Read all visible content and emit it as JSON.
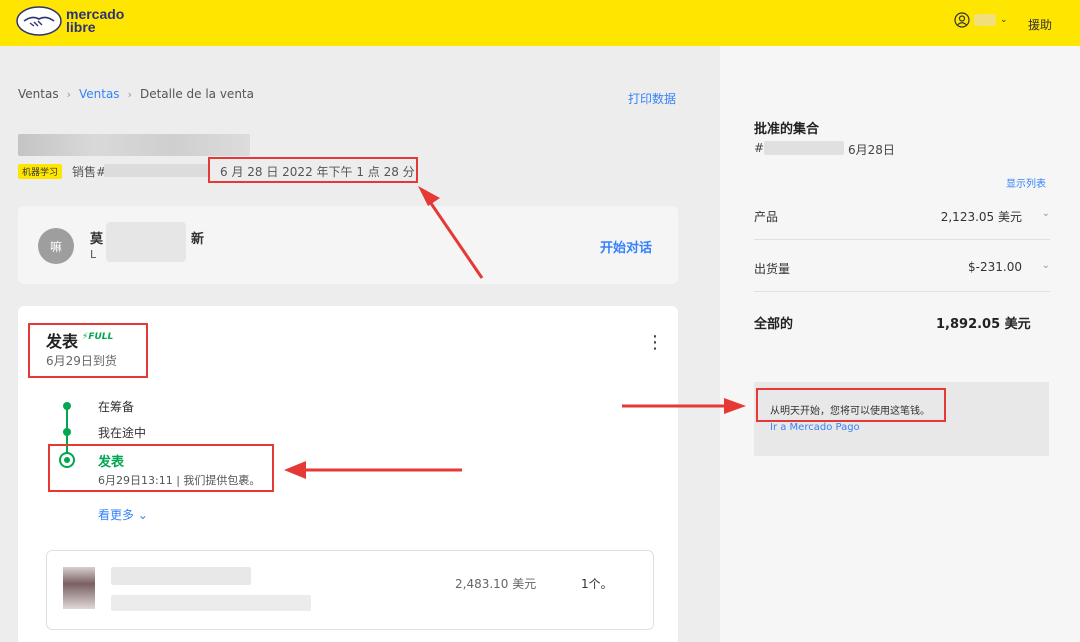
{
  "header": {
    "logo_line1": "mercado",
    "logo_line2": "libre",
    "help_label": "援助",
    "brand_color": "#ffe600"
  },
  "breadcrumb": {
    "items": [
      "Ventas",
      "Ventas",
      "Detalle de la venta"
    ]
  },
  "print_label": "打印数据",
  "sale": {
    "tag": "机器学习",
    "number_prefix": "销售#2",
    "date": "6 月 28 日 2022 年下午 1 点 28 分"
  },
  "buyer": {
    "avatar_initial": "嘛",
    "name_prefix": "莫",
    "name_suffix": "新",
    "sub_prefix": "L",
    "chat_label": "开始对话"
  },
  "shipment": {
    "title": "发表",
    "badge": "FULL",
    "subtitle": "6月29日到货",
    "steps": [
      "在筹备",
      "我在途中"
    ],
    "active_step": "发表",
    "active_detail": "6月29日13:11 | 我们提供包裹。",
    "see_more": "看更多"
  },
  "product": {
    "price": "2,483.10 美元",
    "qty": "1个。"
  },
  "summary": {
    "title": "批准的集合",
    "id_prefix": "#",
    "date": "6月28日",
    "show_list": "显示列表",
    "rows": [
      {
        "label": "产品",
        "value": "2,123.05 美元"
      },
      {
        "label": "出货量",
        "value": "$-231.00"
      }
    ],
    "total_label": "全部的",
    "total_value": "1,892.05 美元"
  },
  "notice": {
    "text": "从明天开始，您将可以使用这笔钱。",
    "link": "Ir a Mercado Pago"
  },
  "colors": {
    "accent": "#3483fa",
    "success": "#00a650",
    "annotation": "#e53935"
  }
}
